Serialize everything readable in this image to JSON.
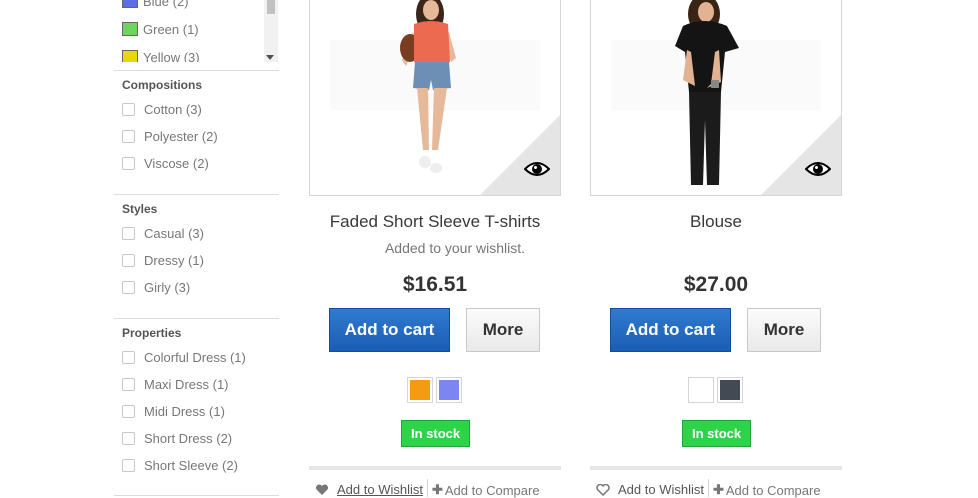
{
  "colors": {
    "items": [
      {
        "label": "Blue (2)",
        "hex": "#5d6dea"
      },
      {
        "label": "Green (1)",
        "hex": "#6fd65d"
      },
      {
        "label": "Yellow (3)",
        "hex": "#e8d60e"
      }
    ]
  },
  "filters": {
    "compositions": {
      "title": "Compositions",
      "items": [
        "Cotton (3)",
        "Polyester (2)",
        "Viscose (2)"
      ]
    },
    "styles": {
      "title": "Styles",
      "items": [
        "Casual (3)",
        "Dressy (1)",
        "Girly (3)"
      ]
    },
    "properties": {
      "title": "Properties",
      "items": [
        "Colorful Dress (1)",
        "Maxi Dress (1)",
        "Midi Dress (1)",
        "Short Dress (2)",
        "Short Sleeve (2)"
      ]
    }
  },
  "products": [
    {
      "name": "Faded Short Sleeve T-shirts",
      "notice": "Added to your wishlist.",
      "price": "$16.51",
      "add_to_cart": "Add to cart",
      "more": "More",
      "swatches": [
        "#f39c11",
        "#7d85f0"
      ],
      "stock": "In stock",
      "wishlist": "Add to Wishlist",
      "compare": "Add to Compare"
    },
    {
      "name": "Blouse",
      "price": "$27.00",
      "add_to_cart": "Add to cart",
      "more": "More",
      "swatches": [
        "#ffffff",
        "#434a54"
      ],
      "stock": "In stock",
      "wishlist": "Add to Wishlist",
      "compare": "Add to Compare"
    }
  ],
  "icons": {
    "quick_view": "eye-icon",
    "wishlist": "heart-icon",
    "compare": "plus-icon"
  }
}
